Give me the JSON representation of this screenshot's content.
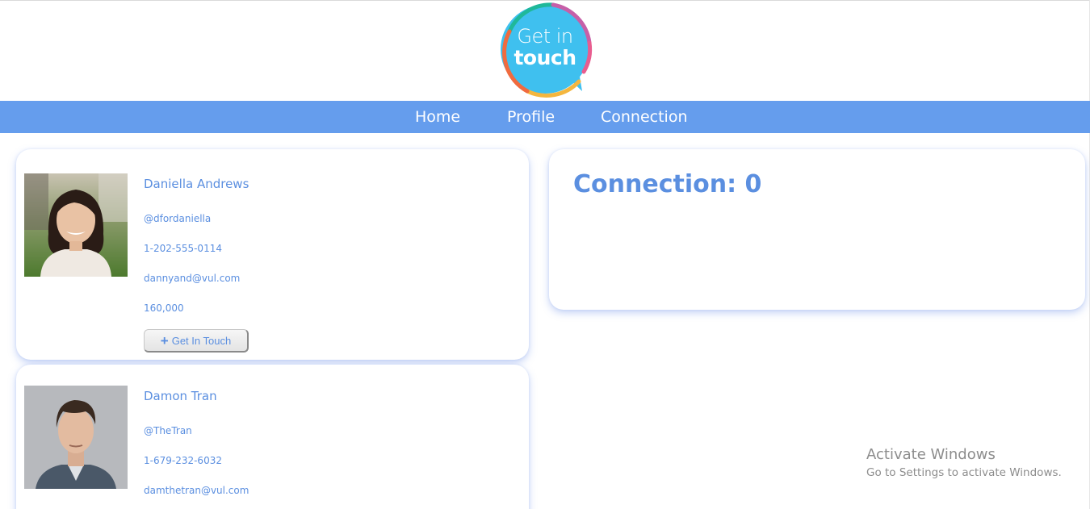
{
  "logo": {
    "line1": "Get in",
    "line2": "touch"
  },
  "nav": {
    "items": [
      "Home",
      "Profile",
      "Connection"
    ]
  },
  "profiles": [
    {
      "name": "Daniella Andrews",
      "handle": "@dfordaniella",
      "phone": "1-202-555-0114",
      "email": "dannyand@vul.com",
      "followers": "160,000",
      "button_label": "Get In Touch",
      "button_icon": "plus-icon"
    },
    {
      "name": "Damon Tran",
      "handle": "@TheTran",
      "phone": "1-679-232-6032",
      "email": "damthetran@vul.com"
    }
  ],
  "connection": {
    "title": "Connection: 0"
  },
  "watermark": {
    "title": "Activate Windows",
    "subtitle": "Go to Settings to activate Windows."
  },
  "colors": {
    "accent": "#5b8fe0",
    "navbar": "#659ded",
    "logo_fill": "#3fc0ef"
  }
}
